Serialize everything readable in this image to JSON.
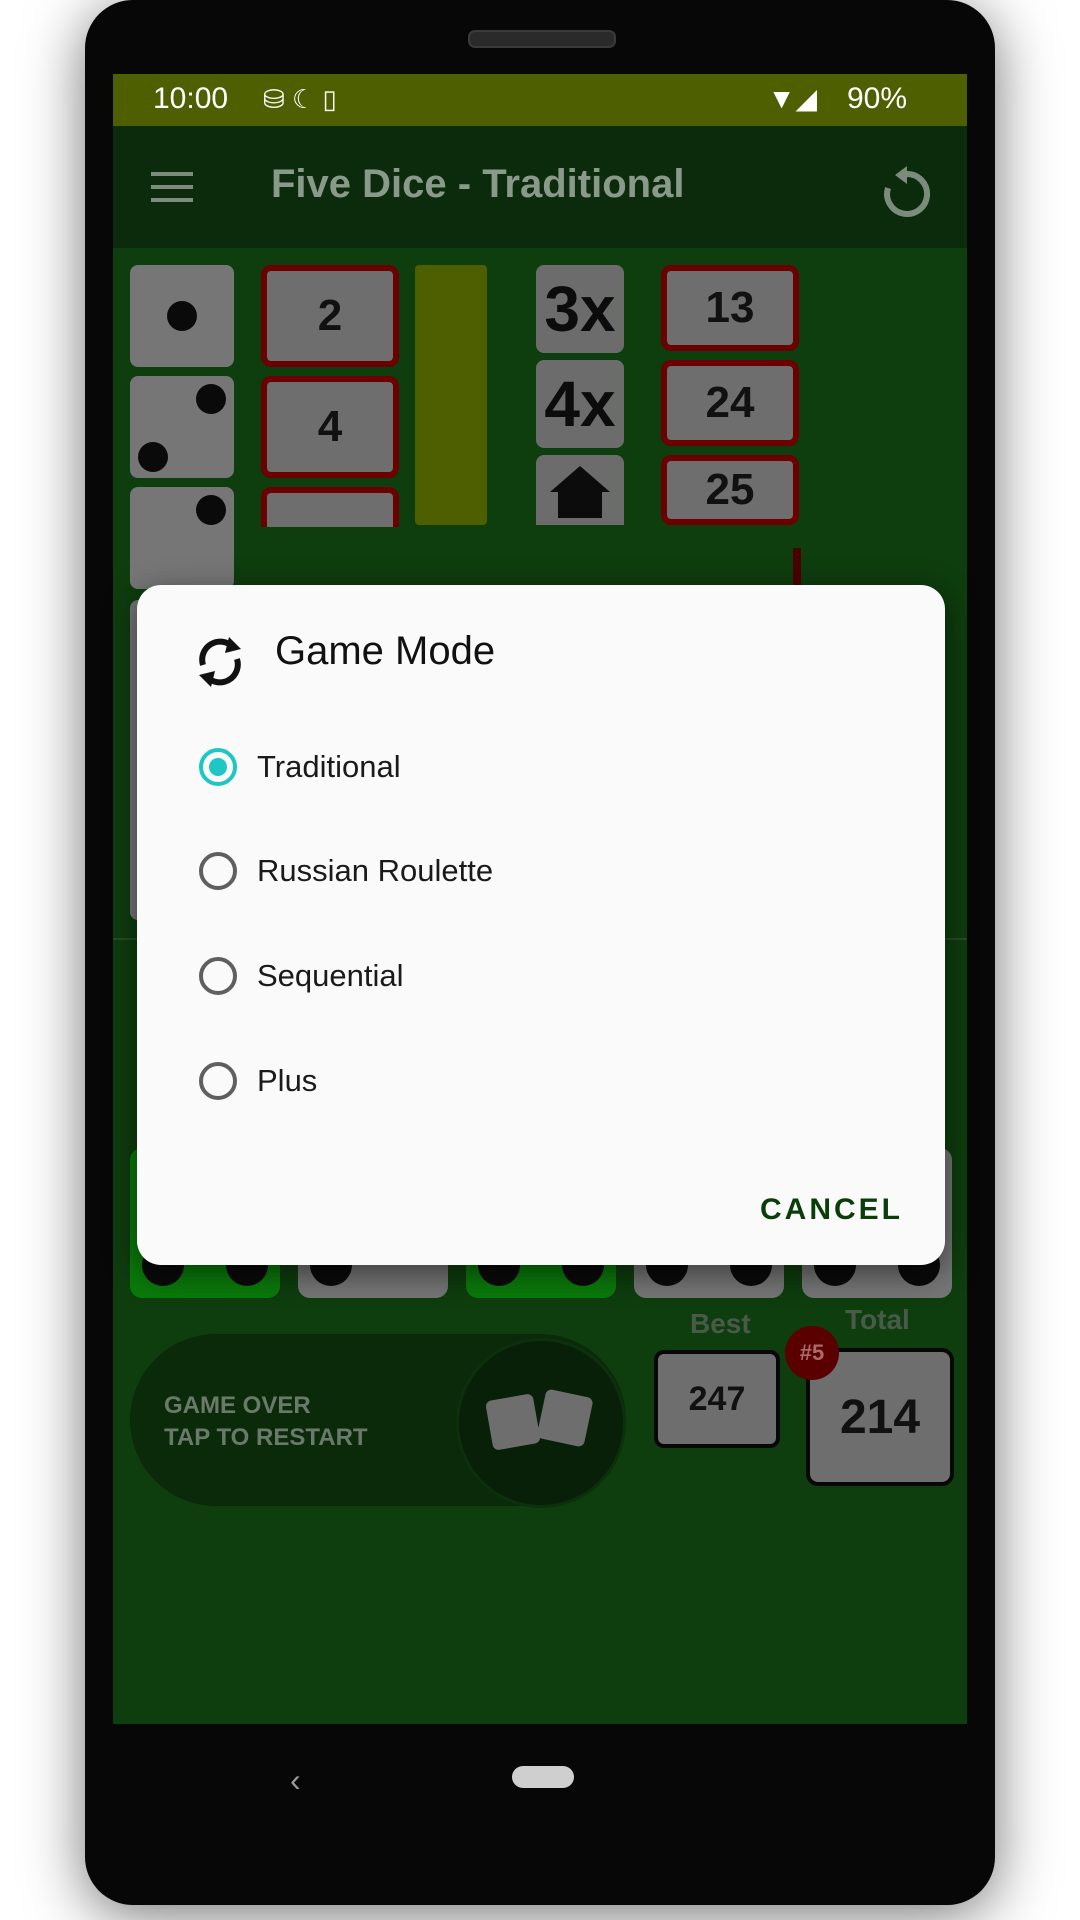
{
  "status": {
    "time": "10:00",
    "battery": "90%"
  },
  "app": {
    "title": "Five Dice - Traditional"
  },
  "scores_left": [
    "2",
    "4"
  ],
  "combos": [
    "3x",
    "4x"
  ],
  "scores_right": [
    "13",
    "24",
    "25"
  ],
  "dialog": {
    "title": "Game Mode",
    "options": [
      {
        "label": "Traditional",
        "selected": true
      },
      {
        "label": "Russian Roulette",
        "selected": false
      },
      {
        "label": "Sequential",
        "selected": false
      },
      {
        "label": "Plus",
        "selected": false
      }
    ],
    "cancel": "CANCEL"
  },
  "bottom": {
    "status_line1": "GAME OVER",
    "status_line2": "TAP TO RESTART",
    "best_label": "Best",
    "best_value": "247",
    "total_label": "Total",
    "total_value": "214",
    "rank_badge": "#5"
  },
  "colors": {
    "accent": "#1ec6c6",
    "appbar": "#4d5f00",
    "board": "#0e3d0e",
    "held_die": "#0a7a0a",
    "score_border": "#6a0000"
  }
}
